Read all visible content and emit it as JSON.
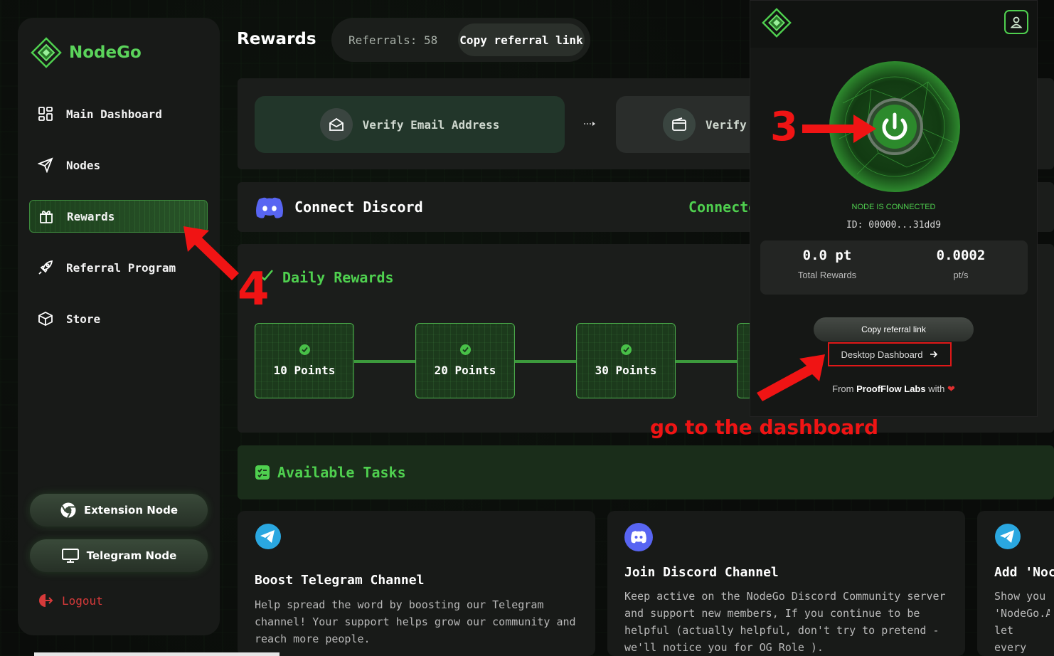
{
  "app": {
    "name": "NodeGo"
  },
  "sidebar": {
    "items": [
      {
        "label": "Main Dashboard",
        "icon": "grid-icon"
      },
      {
        "label": "Nodes",
        "icon": "send-icon"
      },
      {
        "label": "Rewards",
        "icon": "gift-icon",
        "active": true
      },
      {
        "label": "Referral Program",
        "icon": "rocket-icon"
      },
      {
        "label": "Store",
        "icon": "box-icon"
      }
    ],
    "extension_node_label": "Extension Node",
    "telegram_node_label": "Telegram Node",
    "logout_label": "Logout"
  },
  "header": {
    "title": "Rewards",
    "referrals_text": "Referrals: 58",
    "copy_referral_label": "Copy referral link"
  },
  "verify": {
    "email_label": "Verify Email Address",
    "wallet_label": "Verify"
  },
  "discord": {
    "title": "Connect Discord",
    "status": "Connecte"
  },
  "daily_rewards": {
    "title": "Daily Rewards",
    "points": [
      "10 Points",
      "20 Points",
      "30 Points"
    ]
  },
  "tasks": {
    "title": "Available Tasks",
    "cards": [
      {
        "title": "Boost Telegram Channel",
        "description": "Help spread the word by boosting our Telegram channel! Your support helps grow our community and reach more people."
      },
      {
        "title": "Join Discord Channel",
        "description": "Keep active on the NodeGo Discord Community server and support new members, If you continue to be helpful (actually helpful, don't try to pretend - we'll notice you for OG Role )."
      },
      {
        "title": "Add 'Noc",
        "description": "Show you 'NodeGo.A let every decentra"
      }
    ]
  },
  "popup": {
    "status": "NODE IS CONNECTED",
    "id": "ID: 00000...31dd9",
    "points_value": "0.0 pt",
    "points_label": "Total Rewards",
    "rate_value": "0.0002",
    "rate_label": "pt/s",
    "copy_referral_label": "Copy referral link",
    "desktop_dashboard_label": "Desktop Dashboard",
    "from_prefix": "From",
    "from_company": "ProofFlow Labs",
    "from_suffix": "with"
  },
  "annotations": {
    "step3": "3",
    "step4": "4",
    "note": "go to the dashboard"
  },
  "colors": {
    "accent_green": "#4fd04f",
    "annotation_red": "#f01414",
    "sidebar_bg": "#181a18"
  }
}
